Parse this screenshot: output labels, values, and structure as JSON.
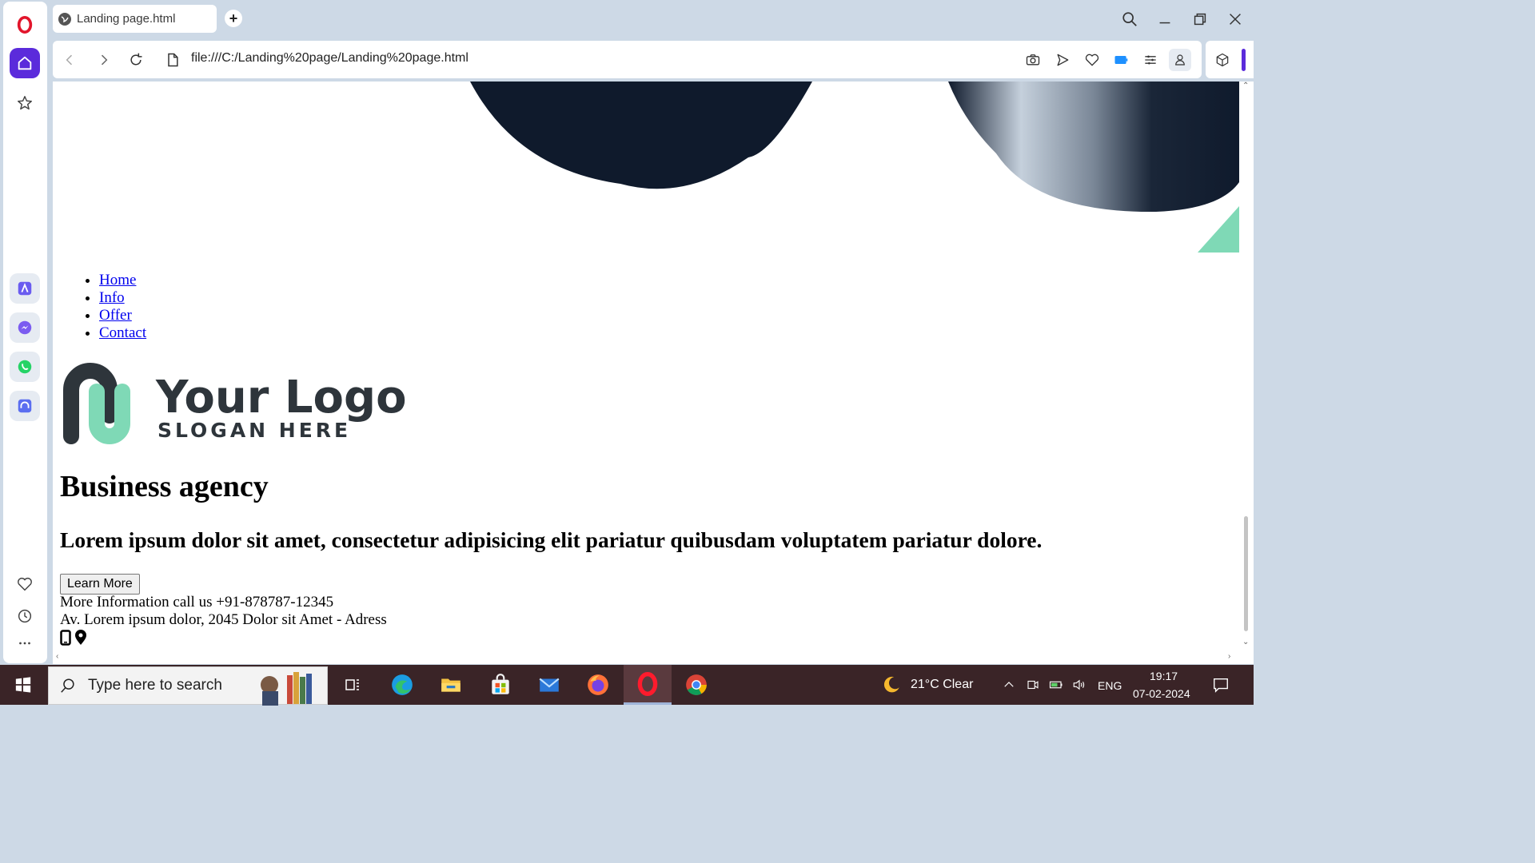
{
  "browser": {
    "tab_title": "Landing page.html",
    "url": "file:///C:/Landing%20page/Landing%20page.html",
    "new_tab_label": "+"
  },
  "sidebar": {
    "items": [
      {
        "name": "opera-logo",
        "icon": "opera-icon"
      },
      {
        "name": "home",
        "icon": "home-icon"
      },
      {
        "name": "speed-dial",
        "icon": "star-icon"
      },
      {
        "name": "aria",
        "icon": "aria-icon"
      },
      {
        "name": "messenger",
        "icon": "messenger-icon"
      },
      {
        "name": "whatsapp",
        "icon": "whatsapp-icon"
      },
      {
        "name": "music-player",
        "icon": "headphones-icon"
      },
      {
        "name": "pinboards",
        "icon": "heart-icon"
      },
      {
        "name": "history",
        "icon": "clock-icon"
      },
      {
        "name": "more",
        "icon": "ellipsis-icon"
      }
    ]
  },
  "page": {
    "nav": [
      "Home",
      "Info",
      "Offer",
      "Contact"
    ],
    "logo": {
      "main": "Your Logo",
      "slogan": "SLOGAN HERE"
    },
    "title": "Business agency",
    "subtitle": "Lorem ipsum dolor sit amet, consectetur adipisicing elit pariatur quibusdam voluptatem pariatur dolore.",
    "button": "Learn More",
    "phone_line": "More Information call us +91-878787-12345",
    "address_line": "Av. Lorem ipsum dolor, 2045 Dolor sit Amet - Adress"
  },
  "taskbar": {
    "search_placeholder": "Type here to search",
    "weather": "21°C  Clear",
    "language": "ENG",
    "time": "19:17",
    "date": "07-02-2024",
    "apps": [
      "task-view",
      "edge",
      "file-explorer",
      "store",
      "mail",
      "firefox",
      "opera",
      "chrome"
    ]
  },
  "colors": {
    "accent": "#5b2bdb",
    "logo_teal": "#7fd9b6",
    "logo_dark": "#2e353b",
    "link": "#0000ee",
    "taskbar": "#3a2427"
  }
}
